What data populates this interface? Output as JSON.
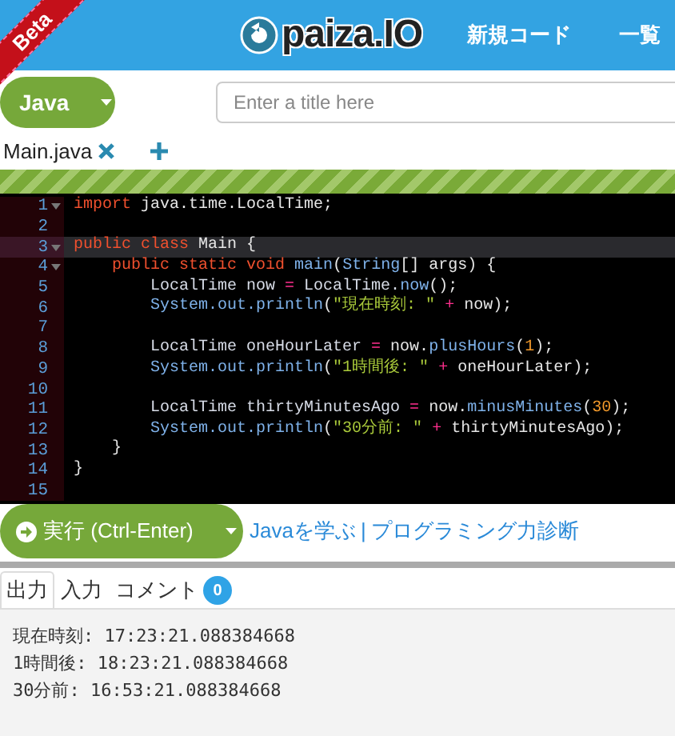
{
  "header": {
    "ribbon": "Beta",
    "logo": "paiza.IO",
    "nav": [
      "新規コード",
      "一覧"
    ]
  },
  "language_button": {
    "label": "Java"
  },
  "title_field": {
    "placeholder": "Enter a title here"
  },
  "file_tabs": [
    {
      "label": "Main.java",
      "selected": true
    }
  ],
  "editor": {
    "lines": [
      {
        "number": "1",
        "fold": true,
        "current": false,
        "tokens": [
          {
            "kind": "keyword",
            "text": "import"
          },
          {
            "kind": "plain",
            "text": " java.time.LocalTime;"
          }
        ]
      },
      {
        "number": "2",
        "fold": false,
        "current": false
      },
      {
        "number": "3",
        "fold": true,
        "current": true,
        "tokens": [
          {
            "kind": "keyword",
            "text": "public class"
          },
          {
            "kind": "plain",
            "text": " Main {"
          }
        ]
      },
      {
        "number": "4",
        "fold": true,
        "current": false,
        "tokens": [
          {
            "kind": "keyword",
            "text": "    public static void"
          },
          {
            "kind": "method",
            "text": " main"
          },
          {
            "kind": "plain",
            "text": "("
          },
          {
            "kind": "method",
            "text": "String"
          },
          {
            "kind": "plain",
            "text": "[] args) {"
          }
        ]
      },
      {
        "number": "5",
        "fold": false,
        "current": false,
        "tokens": [
          {
            "kind": "type",
            "text": "        LocalTime now "
          },
          {
            "kind": "operator",
            "text": "="
          },
          {
            "kind": "type",
            "text": " LocalTime."
          },
          {
            "kind": "method",
            "text": "now"
          },
          {
            "kind": "plain",
            "text": "();"
          }
        ]
      },
      {
        "number": "6",
        "fold": false,
        "current": false,
        "tokens": [
          {
            "kind": "method",
            "text": "        System.out.println"
          },
          {
            "kind": "plain",
            "text": "("
          },
          {
            "kind": "string",
            "text": "\"現在時刻: \""
          },
          {
            "kind": "operator",
            "text": " +"
          },
          {
            "kind": "plain",
            "text": " now);"
          }
        ]
      },
      {
        "number": "7",
        "fold": false,
        "current": false
      },
      {
        "number": "8",
        "fold": false,
        "current": false,
        "tokens": [
          {
            "kind": "type",
            "text": "        LocalTime oneHourLater "
          },
          {
            "kind": "operator",
            "text": "="
          },
          {
            "kind": "plain",
            "text": " now."
          },
          {
            "kind": "method",
            "text": "plusHours"
          },
          {
            "kind": "plain",
            "text": "("
          },
          {
            "kind": "number",
            "text": "1"
          },
          {
            "kind": "plain",
            "text": ");"
          }
        ]
      },
      {
        "number": "9",
        "fold": false,
        "current": false,
        "tokens": [
          {
            "kind": "method",
            "text": "        System.out.println"
          },
          {
            "kind": "plain",
            "text": "("
          },
          {
            "kind": "string",
            "text": "\"1時間後: \""
          },
          {
            "kind": "operator",
            "text": " +"
          },
          {
            "kind": "plain",
            "text": " oneHourLater);"
          }
        ]
      },
      {
        "number": "10",
        "fold": false,
        "current": false
      },
      {
        "number": "11",
        "fold": false,
        "current": false,
        "tokens": [
          {
            "kind": "type",
            "text": "        LocalTime thirtyMinutesAgo "
          },
          {
            "kind": "operator",
            "text": "="
          },
          {
            "kind": "plain",
            "text": " now."
          },
          {
            "kind": "method",
            "text": "minusMinutes"
          },
          {
            "kind": "plain",
            "text": "("
          },
          {
            "kind": "number",
            "text": "30"
          },
          {
            "kind": "plain",
            "text": ");"
          }
        ]
      },
      {
        "number": "12",
        "fold": false,
        "current": false,
        "tokens": [
          {
            "kind": "method",
            "text": "        System.out.println"
          },
          {
            "kind": "plain",
            "text": "("
          },
          {
            "kind": "string",
            "text": "\"30分前: \""
          },
          {
            "kind": "operator",
            "text": " +"
          },
          {
            "kind": "plain",
            "text": " thirtyMinutesAgo);"
          }
        ]
      },
      {
        "number": "13",
        "fold": false,
        "current": false,
        "tokens": [
          {
            "kind": "plain",
            "text": "    }"
          }
        ]
      },
      {
        "number": "14",
        "fold": false,
        "current": false,
        "tokens": [
          {
            "kind": "plain",
            "text": "}"
          }
        ]
      },
      {
        "number": "15",
        "fold": false,
        "current": false
      }
    ]
  },
  "run_button": {
    "label": "実行 (Ctrl-Enter)"
  },
  "links": [
    {
      "kind": "link",
      "text": "Javaを学ぶ"
    },
    {
      "kind": "separator",
      "text": "|"
    },
    {
      "kind": "link",
      "text": "プログラミング力診断"
    }
  ],
  "output_tabs": [
    {
      "label": "出力",
      "selected": true
    },
    {
      "label": "入力",
      "selected": false
    },
    {
      "label": "コメント",
      "selected": false,
      "badge": "0"
    }
  ],
  "output": [
    "現在時刻: 17:23:21.088384668",
    "1時間後: 18:23:21.088384668",
    "30分前: 16:53:21.088384668"
  ]
}
